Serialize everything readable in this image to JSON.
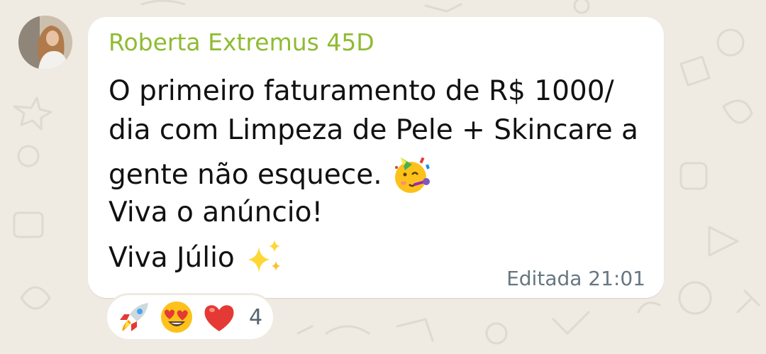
{
  "message": {
    "sender_name": "Roberta Extremus 45D",
    "sender_color": "#8fbb32",
    "lines": [
      "O primeiro faturamento de R$ 1000/",
      "dia com Limpeza de Pele + Skincare a",
      "gente não esquece.",
      "Viva o anúncio!",
      "Viva Júlio"
    ],
    "inline_emojis": [
      "partying-face",
      "sparkles"
    ],
    "timestamp": "Editada 21:01"
  },
  "reactions": {
    "emojis": [
      "rocket",
      "heart-eyes",
      "red-heart"
    ],
    "count": "4"
  },
  "colors": {
    "wallpaper": "#efeae2",
    "bubble": "#ffffff",
    "text": "#111111",
    "timestamp": "#667781"
  }
}
